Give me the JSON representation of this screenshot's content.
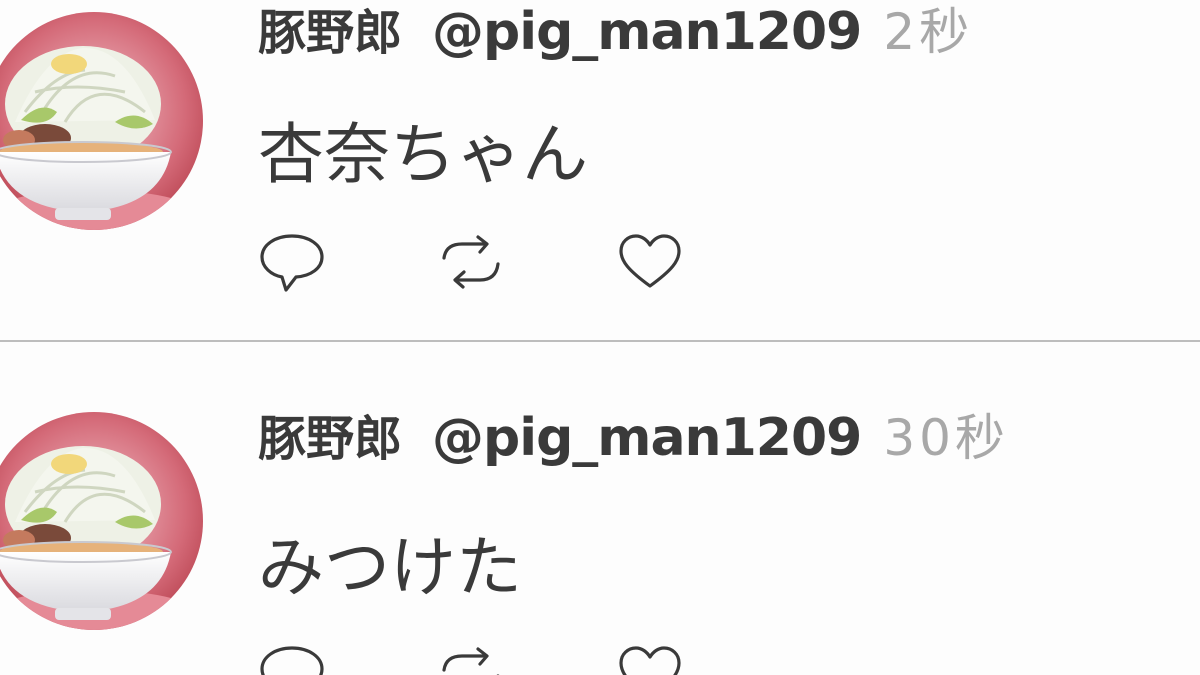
{
  "tweets": [
    {
      "display_name": "豚野郎",
      "handle": "@pig_man1209",
      "time": "2秒",
      "text": "杏奈ちゃん",
      "avatar_icon": "ramen-bowl-avatar-icon",
      "actions": [
        "reply-icon",
        "retweet-icon",
        "like-icon"
      ]
    },
    {
      "display_name": "豚野郎",
      "handle": "@pig_man1209",
      "time": "30秒",
      "text": "みつけた",
      "avatar_icon": "ramen-bowl-avatar-icon",
      "actions": [
        "reply-icon",
        "retweet-icon",
        "like-icon"
      ]
    }
  ],
  "colors": {
    "background": "#fdfdfd",
    "text": "#3a3a3a",
    "timestamp": "#a8a8a8",
    "divider": "#bdbdbd",
    "avatar_background": "#c8505e"
  }
}
